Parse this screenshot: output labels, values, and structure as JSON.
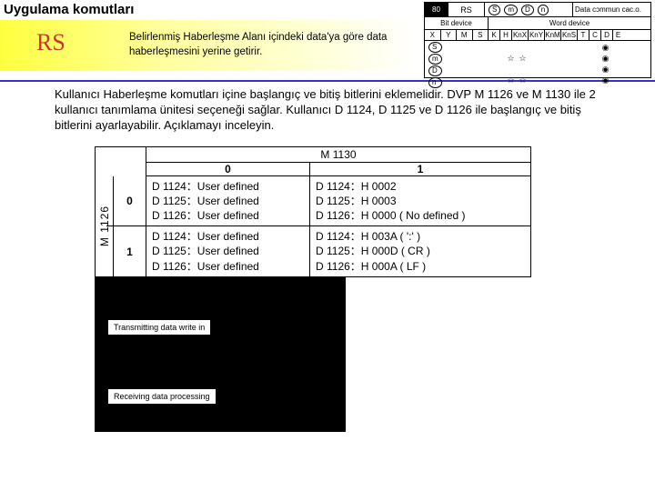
{
  "header": {
    "title": "Uygulama komutları",
    "mnemonic": "RS",
    "description": "Belirlenmiş Haberleşme Alanı içindeki data'ya göre data haberleşmesini yerine getirir."
  },
  "infobox": {
    "api_no": "80",
    "mnem": "RS",
    "operands": [
      "S",
      "m",
      "D",
      "n"
    ],
    "data_comm_label": "Data cɔmmun cac.o.",
    "bit_device_label": "Bit device",
    "word_device_label": "Word device",
    "bit_cols": [
      "X",
      "Y",
      "M",
      "S"
    ],
    "word_cols": [
      "K",
      "H",
      "KnX",
      "KnY",
      "KnM",
      "KnS",
      "T",
      "C",
      "D",
      "E"
    ],
    "op_rows": [
      "S",
      "m",
      "D",
      "n"
    ]
  },
  "body_text": "Kullanıcı Haberleşme komutları içine başlangıç ve bitiş bitlerini eklemelidir. DVP M 1126 ve M 1130 ile 2 kullanıcı tanımlama ünitesi seçeneği sağlar. Kullanıcı D 1124, D 1125 ve D 1126 ile başlangıç ve bitiş bitlerini ayarlayabilir. Açıklamayı inceleyin.",
  "m1130": {
    "title": "M 1130",
    "side_label": "M 1126",
    "col_headers": [
      "0",
      "1"
    ],
    "row_headers": [
      "0",
      "1"
    ],
    "cells": [
      [
        [
          "D 1124：User defined",
          "D 1125：User defined",
          "D 1126：User defined"
        ],
        [
          "D 1124：H 0002",
          "D 1125：H 0003",
          "D 1126：H 0000 ( No defined )"
        ]
      ],
      [
        [
          "D 1124：User defined",
          "D 1125：User defined",
          "D 1126：User defined"
        ],
        [
          "D 1124：H 003A ( ':' )",
          "D 1125：H 000D ( CR )",
          "D 1126：H 000A ( LF )"
        ]
      ]
    ]
  },
  "black_panel": {
    "box1": "Transmitting data write in",
    "box2": "Receiving data processing"
  }
}
